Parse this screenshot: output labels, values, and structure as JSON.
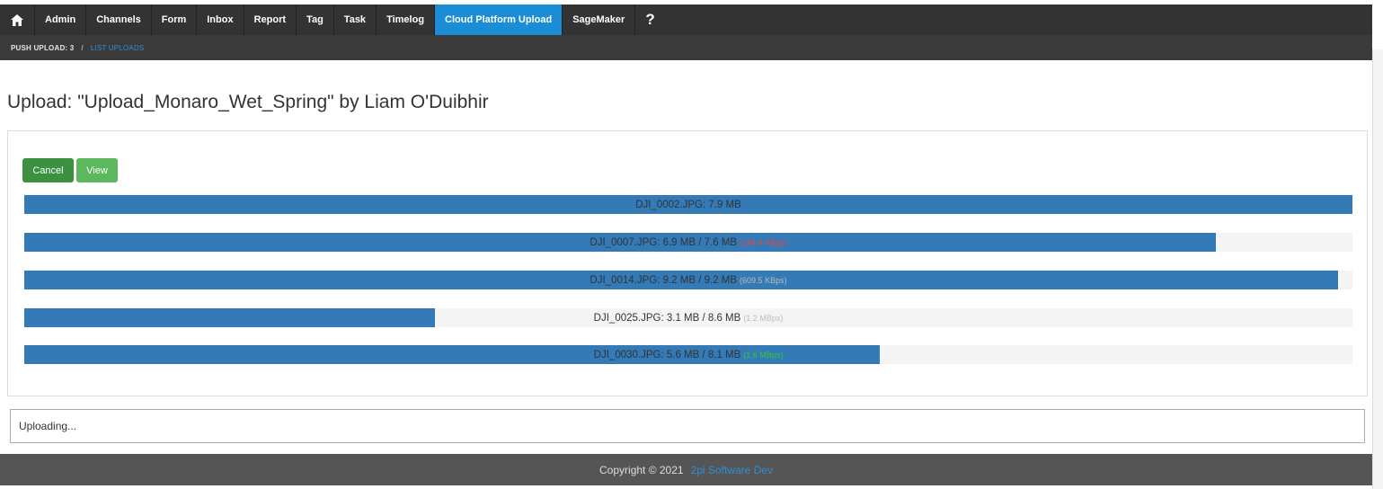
{
  "nav": {
    "home_icon": "home-icon",
    "items": [
      {
        "label": "Admin",
        "active": false
      },
      {
        "label": "Channels",
        "active": false
      },
      {
        "label": "Form",
        "active": false
      },
      {
        "label": "Inbox",
        "active": false
      },
      {
        "label": "Report",
        "active": false
      },
      {
        "label": "Tag",
        "active": false
      },
      {
        "label": "Task",
        "active": false
      },
      {
        "label": "Timelog",
        "active": false
      },
      {
        "label": "Cloud Platform Upload",
        "active": true
      },
      {
        "label": "SageMaker",
        "active": false
      }
    ],
    "help_label": "?"
  },
  "breadcrumb": {
    "current": "PUSH UPLOAD: 3",
    "separator": "/",
    "link": "LIST UPLOADS"
  },
  "page": {
    "title": "Upload: \"Upload_Monaro_Wet_Spring\" by Liam O'Duibhir"
  },
  "actions": {
    "cancel_label": "Cancel",
    "view_label": "View"
  },
  "uploads": [
    {
      "label": "DJI_0002.JPG: 7.9 MB",
      "speed": "",
      "speed_color": "",
      "progress_pct": 100
    },
    {
      "label": "DJI_0007.JPG: 6.9 MB / 7.6 MB",
      "speed": "(184.4 KBps)",
      "speed_color": "#e8453c",
      "progress_pct": 89.7
    },
    {
      "label": "DJI_0014.JPG: 9.2 MB / 9.2 MB",
      "speed": "(609.5 KBps)",
      "speed_color": "#bbbbbb",
      "progress_pct": 98.9
    },
    {
      "label": "DJI_0025.JPG: 3.1 MB / 8.6 MB",
      "speed": "(1.2 MBps)",
      "speed_color": "#bbbbbb",
      "progress_pct": 30.9
    },
    {
      "label": "DJI_0030.JPG: 5.6 MB / 8.1 MB",
      "speed": "(1.6 MBps)",
      "speed_color": "#33cc33",
      "progress_pct": 64.4
    }
  ],
  "status": {
    "text": "Uploading..."
  },
  "footer": {
    "copyright": "Copyright © 2021",
    "company": "2pi Software Dev"
  },
  "colors": {
    "nav_bg": "#333333",
    "nav_active": "#1a8dd6",
    "progress_fill": "#337ab7",
    "cancel_btn": "#3c9140",
    "view_btn": "#5cb85c"
  }
}
